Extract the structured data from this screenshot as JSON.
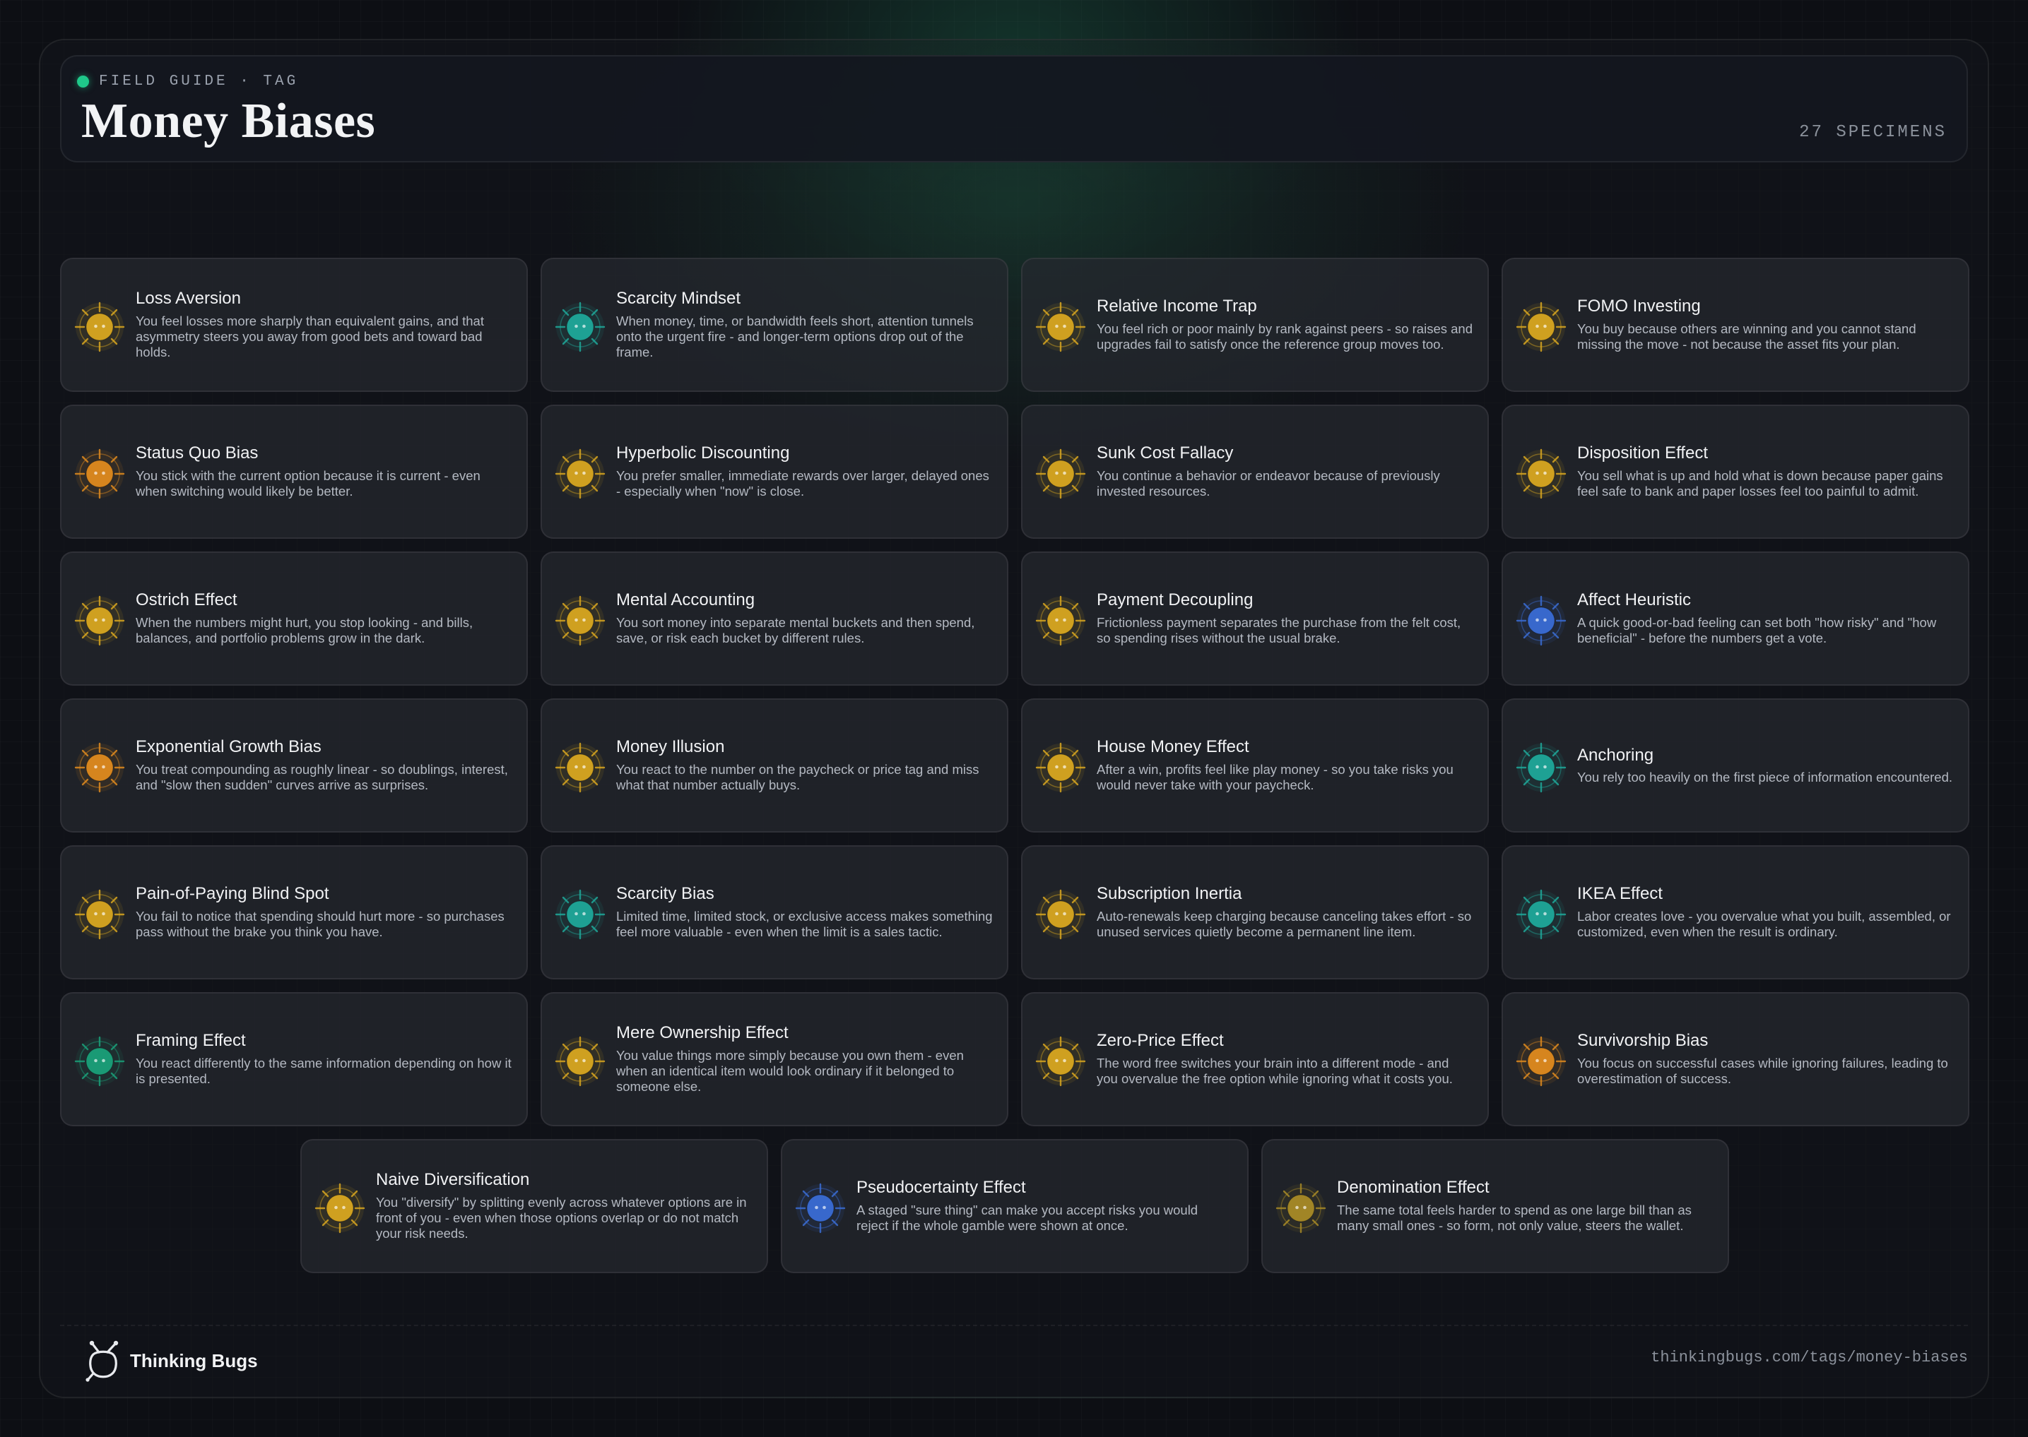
{
  "header": {
    "kicker": "FIELD GUIDE · TAG",
    "title": "Money Biases",
    "count": "27 SPECIMENS"
  },
  "icon_colors": {
    "gold": "#d8a620",
    "teal": "#1fa89a",
    "orange": "#df8a1e",
    "blue": "#3a6cd4",
    "green": "#1aa079",
    "dim-gold": "#a88a26"
  },
  "cards": [
    {
      "title": "Loss Aversion",
      "desc": "You feel losses more sharply than equivalent gains, and that asymmetry steers you away from good bets and toward bad holds.",
      "icon": "gold-bug-icon",
      "color": "gold"
    },
    {
      "title": "Scarcity Mindset",
      "desc": "When money, time, or bandwidth feels short, attention tunnels onto the urgent fire - and longer-term options drop out of the frame.",
      "icon": "teal-bug-icon",
      "color": "teal"
    },
    {
      "title": "Relative Income Trap",
      "desc": "You feel rich or poor mainly by rank against peers - so raises and upgrades fail to satisfy once the reference group moves too.",
      "icon": "gold-bug-icon",
      "color": "gold"
    },
    {
      "title": "FOMO Investing",
      "desc": "You buy because others are winning and you cannot stand missing the move - not because the asset fits your plan.",
      "icon": "gold-bug-icon",
      "color": "gold"
    },
    {
      "title": "Status Quo Bias",
      "desc": "You stick with the current option because it is current - even when switching would likely be better.",
      "icon": "orange-bug-icon",
      "color": "orange"
    },
    {
      "title": "Hyperbolic Discounting",
      "desc": "You prefer smaller, immediate rewards over larger, delayed ones - especially when \"now\" is close.",
      "icon": "gold-bug-icon",
      "color": "gold"
    },
    {
      "title": "Sunk Cost Fallacy",
      "desc": "You continue a behavior or endeavor because of previously invested resources.",
      "icon": "gold-bug-icon",
      "color": "gold"
    },
    {
      "title": "Disposition Effect",
      "desc": "You sell what is up and hold what is down because paper gains feel safe to bank and paper losses feel too painful to admit.",
      "icon": "gold-bug-icon",
      "color": "gold"
    },
    {
      "title": "Ostrich Effect",
      "desc": "When the numbers might hurt, you stop looking - and bills, balances, and portfolio problems grow in the dark.",
      "icon": "gold-bug-icon",
      "color": "gold"
    },
    {
      "title": "Mental Accounting",
      "desc": "You sort money into separate mental buckets and then spend, save, or risk each bucket by different rules.",
      "icon": "gold-bug-icon",
      "color": "gold"
    },
    {
      "title": "Payment Decoupling",
      "desc": "Frictionless payment separates the purchase from the felt cost, so spending rises without the usual brake.",
      "icon": "gold-bug-icon",
      "color": "gold"
    },
    {
      "title": "Affect Heuristic",
      "desc": "A quick good-or-bad feeling can set both \"how risky\" and \"how beneficial\" - before the numbers get a vote.",
      "icon": "blue-bug-icon",
      "color": "blue"
    },
    {
      "title": "Exponential Growth Bias",
      "desc": "You treat compounding as roughly linear - so doublings, interest, and \"slow then sudden\" curves arrive as surprises.",
      "icon": "orange-bug-icon",
      "color": "orange"
    },
    {
      "title": "Money Illusion",
      "desc": "You react to the number on the paycheck or price tag and miss what that number actually buys.",
      "icon": "gold-bug-icon",
      "color": "gold"
    },
    {
      "title": "House Money Effect",
      "desc": "After a win, profits feel like play money - so you take risks you would never take with your paycheck.",
      "icon": "gold-bug-icon",
      "color": "gold"
    },
    {
      "title": "Anchoring",
      "desc": "You rely too heavily on the first piece of information encountered.",
      "icon": "teal-bug-icon",
      "color": "teal"
    },
    {
      "title": "Pain-of-Paying Blind Spot",
      "desc": "You fail to notice that spending should hurt more - so purchases pass without the brake you think you have.",
      "icon": "gold-bug-icon",
      "color": "gold"
    },
    {
      "title": "Scarcity Bias",
      "desc": "Limited time, limited stock, or exclusive access makes something feel more valuable - even when the limit is a sales tactic.",
      "icon": "teal-bug-icon",
      "color": "teal"
    },
    {
      "title": "Subscription Inertia",
      "desc": "Auto-renewals keep charging because canceling takes effort - so unused services quietly become a permanent line item.",
      "icon": "gold-bug-icon",
      "color": "gold"
    },
    {
      "title": "IKEA Effect",
      "desc": "Labor creates love - you overvalue what you built, assembled, or customized, even when the result is ordinary.",
      "icon": "teal-bug-icon",
      "color": "teal"
    },
    {
      "title": "Framing Effect",
      "desc": "You react differently to the same information depending on how it is presented.",
      "icon": "green-bug-icon",
      "color": "green"
    },
    {
      "title": "Mere Ownership Effect",
      "desc": "You value things more simply because you own them - even when an identical item would look ordinary if it belonged to someone else.",
      "icon": "gold-bug-icon",
      "color": "gold"
    },
    {
      "title": "Zero-Price Effect",
      "desc": "The word free switches your brain into a different mode - and you overvalue the free option while ignoring what it costs you.",
      "icon": "gold-bug-icon",
      "color": "gold"
    },
    {
      "title": "Survivorship Bias",
      "desc": "You focus on successful cases while ignoring failures, leading to overestimation of success.",
      "icon": "orange-bug-icon",
      "color": "orange"
    },
    {
      "title": "Naive Diversification",
      "desc": "You \"diversify\" by splitting evenly across whatever options are in front of you - even when those options overlap or do not match your risk needs.",
      "icon": "gold-bug-icon",
      "color": "gold"
    },
    {
      "title": "Pseudocertainty Effect",
      "desc": "A staged \"sure thing\" can make you accept risks you would reject if the whole gamble were shown at once.",
      "icon": "blue-bug-icon",
      "color": "blue"
    },
    {
      "title": "Denomination Effect",
      "desc": "The same total feels harder to spend as one large bill than as many small ones - so form, not only value, steers the wallet.",
      "icon": "dim-gold-bug-icon",
      "color": "dim-gold"
    }
  ],
  "footer": {
    "brand": "Thinking Bugs",
    "url": "thinkingbugs.com/tags/money-biases"
  }
}
